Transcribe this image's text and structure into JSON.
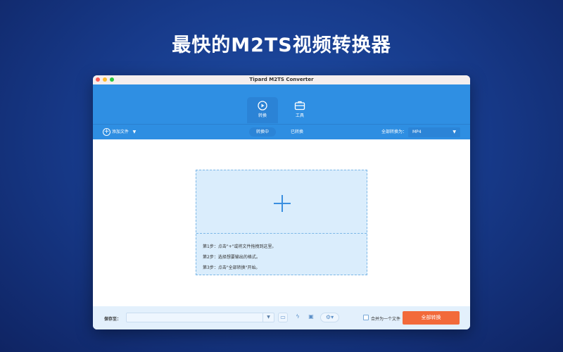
{
  "headline": "最快的M2TS视频转换器",
  "window": {
    "title": "Tipard M2TS Converter"
  },
  "tabs": [
    {
      "label": "转换",
      "icon": "convert-icon"
    },
    {
      "label": "工具",
      "icon": "toolbox-icon"
    }
  ],
  "toolbar": {
    "add_files": "添加文件",
    "converting": "转换中",
    "converted": "已转换",
    "convert_all_to": "全部转换为：",
    "format": "MP4"
  },
  "drop": {
    "steps": [
      "第1步：点击\"+\"或将文件拖拽到这里。",
      "第2步：选择想要输出的格式。",
      "第3步：点击\"全部转换\"开始。"
    ]
  },
  "bottom": {
    "save_to": "保存至：",
    "path": "",
    "merge": "合并为一个文件",
    "convert_all": "全部转换"
  },
  "colors": {
    "accent": "#2f8fe3",
    "convert_button": "#f26a3a"
  }
}
